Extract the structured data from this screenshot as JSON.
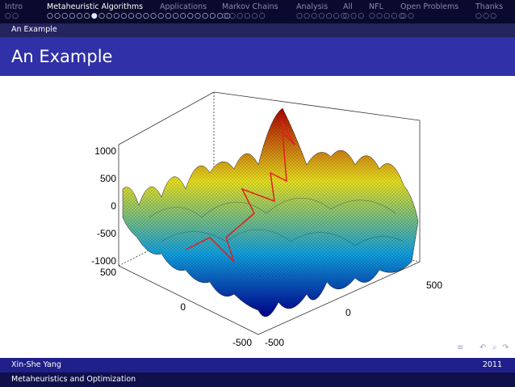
{
  "nav": {
    "items": [
      {
        "label": "Intro",
        "dots": "○○",
        "active": false
      },
      {
        "label": "Metaheuristic Algorithms",
        "dots": "○○○○○○●○○○○○○○○○○○○○○○○○○",
        "active": true
      },
      {
        "label": "Applications",
        "dots": "",
        "active": false
      },
      {
        "label": "Markov Chains",
        "dots": "○○○○○○",
        "active": false
      },
      {
        "label": "Analysis",
        "dots": "○○○○○○○",
        "active": false
      },
      {
        "label": "All",
        "dots": "○○○",
        "active": false
      },
      {
        "label": "NFL",
        "dots": "○○○○○",
        "active": false
      },
      {
        "label": "Open Problems",
        "dots": "○○",
        "active": false
      },
      {
        "label": "Thanks",
        "dots": "○○○",
        "active": false
      }
    ]
  },
  "subsection": "An Example",
  "frame_title": "An Example",
  "figure": {
    "z_ticks": [
      "1000",
      "500",
      "0",
      "-500",
      "-1000"
    ],
    "y_ticks": [
      "500",
      "0",
      "-500"
    ],
    "x_ticks": [
      "-500",
      "0",
      "500"
    ],
    "colors": {
      "high": "#b00000",
      "mid": "#e8e020",
      "low": "#10a0e0",
      "deep": "#000090",
      "path": "#e02020"
    }
  },
  "footer": {
    "author": "Xin-She Yang",
    "year": "2011",
    "talk": "Metaheuristics and Optimization"
  }
}
